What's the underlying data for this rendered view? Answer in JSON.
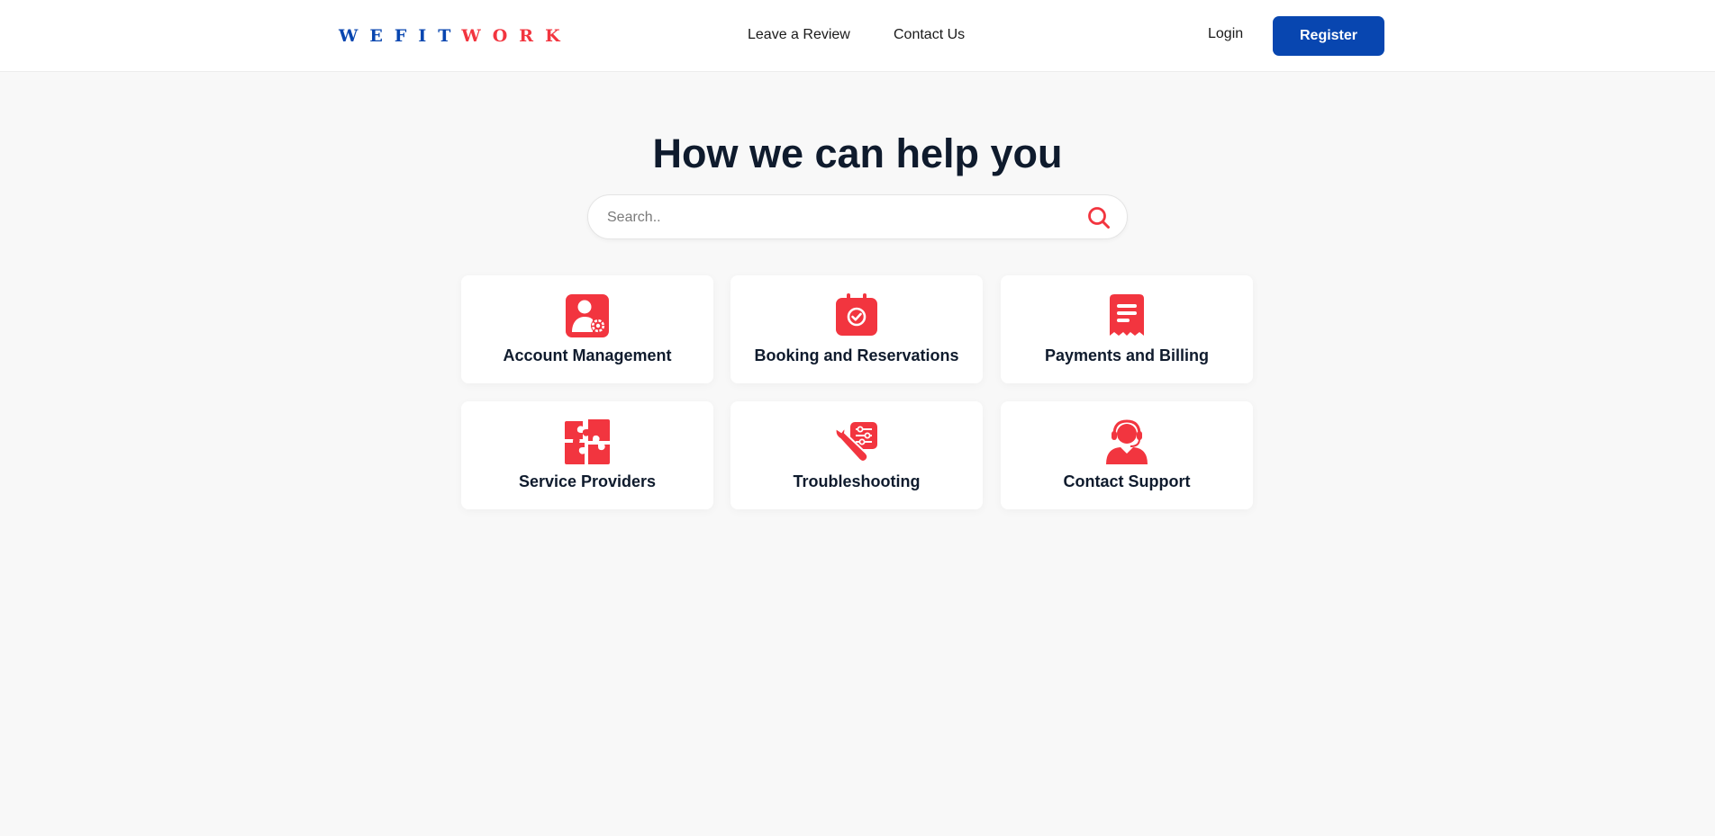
{
  "brand": {
    "logo_part1": "WEFIT",
    "logo_part2": "WORK"
  },
  "nav": {
    "review": "Leave a Review",
    "contact": "Contact Us"
  },
  "auth": {
    "login": "Login",
    "register": "Register"
  },
  "hero": {
    "title": "How we can help you"
  },
  "search": {
    "placeholder": "Search.."
  },
  "categories": [
    {
      "label": "Account Management",
      "icon": "account-settings-icon"
    },
    {
      "label": "Booking and Reservations",
      "icon": "calendar-check-icon"
    },
    {
      "label": "Payments and Billing",
      "icon": "receipt-icon"
    },
    {
      "label": "Service Providers",
      "icon": "puzzle-icon"
    },
    {
      "label": "Troubleshooting",
      "icon": "wrench-icon"
    },
    {
      "label": "Contact Support",
      "icon": "headset-agent-icon"
    }
  ],
  "colors": {
    "brand_blue": "#0846b0",
    "accent_red": "#f2353f",
    "background": "#f8f8f8"
  }
}
